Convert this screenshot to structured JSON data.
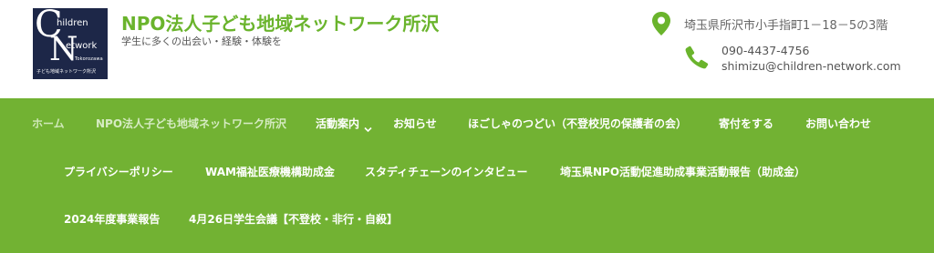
{
  "logo": {
    "line1": "hildren",
    "line2": "etwork",
    "big_c": "C",
    "big_n": "N",
    "tokorozawa": "Tokorozawa",
    "caption": "子ども地域ネットワーク所沢"
  },
  "site": {
    "title": "NPO法人子ども地域ネットワーク所沢",
    "tagline": "学生に多くの出会い・経験・体験を"
  },
  "contact": {
    "address": "埼玉県所沢市小手指町1－18－5の3階",
    "phone": "090-4437-4756",
    "email": "shimizu@children-network.com"
  },
  "nav": {
    "items": [
      {
        "label": "ホーム"
      },
      {
        "label": "NPO法人子ども地域ネットワーク所沢"
      },
      {
        "label": "活動案内"
      },
      {
        "label": "お知らせ"
      },
      {
        "label": "ほごしゃのつどい（不登校児の保護者の会）"
      },
      {
        "label": "寄付をする"
      },
      {
        "label": "お問い合わせ"
      },
      {
        "label": "プライバシーポリシー"
      },
      {
        "label": "WAM福祉医療機構助成金"
      },
      {
        "label": "スタディチェーンのインタビュー"
      },
      {
        "label": "埼玉県NPO活動促進助成事業活動報告（助成金）"
      },
      {
        "label": "2024年度事業報告"
      },
      {
        "label": "4月26日学生会議【不登校・非行・自殺】"
      }
    ]
  },
  "colors": {
    "brand_green": "#6ab42c",
    "nav_bg": "#72b233",
    "logo_bg": "#1d2748"
  },
  "icons": {
    "address": "map-pin-icon",
    "phone": "phone-icon",
    "dropdown": "chevron-down-icon"
  }
}
